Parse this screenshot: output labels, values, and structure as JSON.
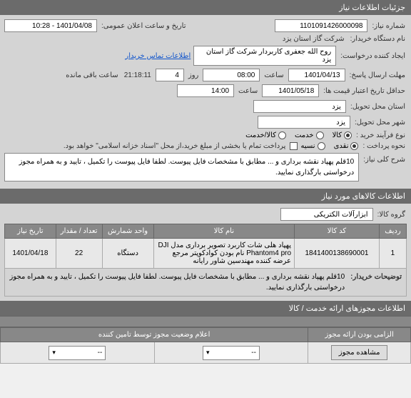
{
  "sections": {
    "main_header": "جزئیات اطلاعات نیاز",
    "need_overview": "شرح کلی نیاز:",
    "goods_info": "اطلاعات کالاهای مورد نیاز",
    "permits": "اطلاعات مجوزهای ارائه خدمت / کالا",
    "status_header": "اعلام وضعیت مجوز توسط تامین کننده"
  },
  "labels": {
    "need_no": "شماره نیاز:",
    "announce_date": "تاریخ و ساعت اعلان عمومی:",
    "buyer_org": "نام دستگاه خریدار:",
    "request_creator": "ایجاد کننده درخواست:",
    "contact_info": "اطلاعات تماس خریدار",
    "reply_deadline": "مهلت ارسال پاسخ:",
    "time": "ساعت",
    "day": "روز",
    "remaining": "ساعت باقی مانده",
    "min_credit_date": "حداقل تاریخ اعتبار قیمت ها:",
    "delivery_province": "استان محل تحویل:",
    "delivery_city": "شهر محل تحویل:",
    "process_type": "نوع فرآیند خرید :",
    "payment_method": "نحوه پرداخت :",
    "treasury_note": "پرداخت تمام یا بخشی از مبلغ خرید،از محل \"اسناد خزانه اسلامی\" خواهد بود.",
    "goods_group": "گروه کالا:",
    "buyer_notes": "توضیحات خریدار:",
    "permit_required": "الزامی بودن ارائه مجوز"
  },
  "values": {
    "need_no": "1101091426000098",
    "announce_date": "1401/04/08 - 10:28",
    "buyer_org": "شرکت گاز استان یزد",
    "request_creator": "روح الله جعفری کاربردار شرکت گاز استان یزد",
    "reply_date": "1401/04/13",
    "reply_time": "08:00",
    "reply_days": "4",
    "reply_remaining": "21:18:11",
    "min_credit_date": "1401/05/18",
    "min_credit_time": "14:00",
    "delivery_province": "یزد",
    "delivery_city": "یزد",
    "goods_group": "ابزارآلات الکتریکی",
    "need_overview_text": "10قلم پهپاد نقشه برداری و ... مطابق با مشخصات فایل پیوست. لطفا فایل پیوست را تکمیل ، تایید و به همراه مجوز درخواستی بارگذاری نمایید.",
    "buyer_notes_text": "10قلم پهپاد نقشه برداری و ... مطابق با مشخصات فایل پیوست. لطفا فایل پیوست را تکمیل ، تایید و به همراه مجوز درخواستی بارگذاری نمایید."
  },
  "radios": {
    "process": {
      "options": [
        "کالا",
        "خدمت",
        "کالا/خدمت"
      ],
      "selected": "کالا"
    },
    "payment": {
      "options": [
        "نقدی",
        "نسیه"
      ],
      "selected": "نقدی"
    }
  },
  "table": {
    "headers": [
      "ردیف",
      "کد کالا",
      "نام کالا",
      "واحد شمارش",
      "تعداد / مقدار",
      "تاریخ نیاز"
    ],
    "rows": [
      {
        "idx": "1",
        "code": "1841400138690001",
        "name": "پهپاد هلی شات کاربرد تصویر برداری مدل DJI Phantom4 pro نام بودن کوادکوپتر مرجع عرضه کننده مهندسین شاور رایانه",
        "unit": "دستگاه",
        "qty": "22",
        "date": "1401/04/18"
      }
    ]
  },
  "buttons": {
    "view_permit": "مشاهده مجوز"
  },
  "select": {
    "placeholder": "--"
  },
  "chart_data": null
}
